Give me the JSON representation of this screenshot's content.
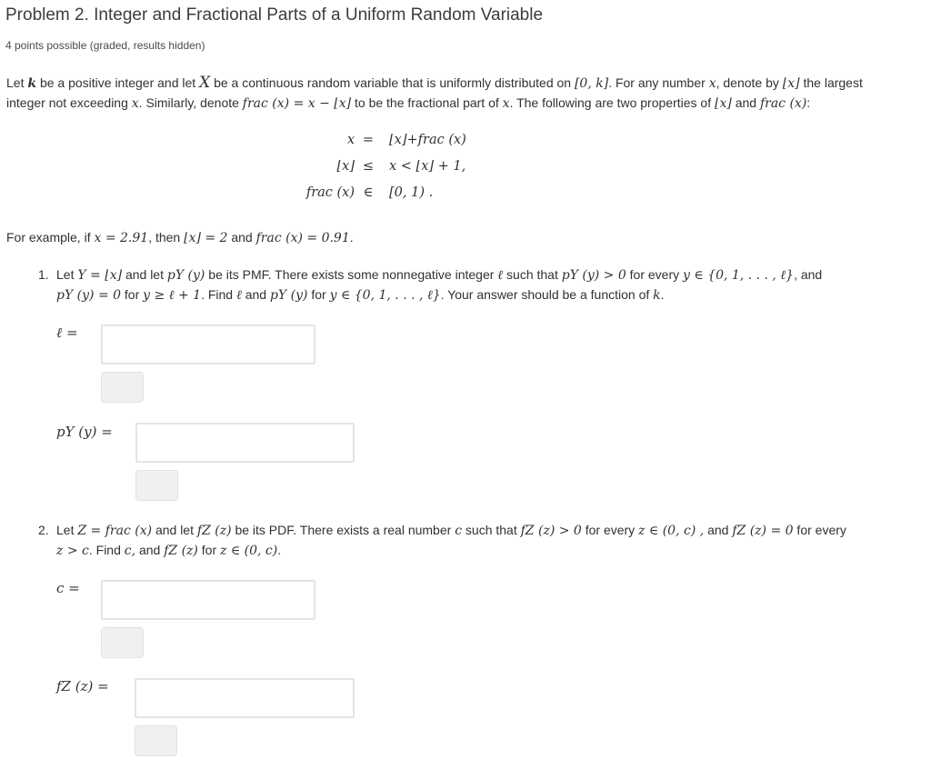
{
  "header": {
    "title": "Problem 2. Integer and Fractional Parts of a Uniform Random Variable",
    "subtitle": "4 points possible (graded, results hidden)"
  },
  "intro": {
    "line1": [
      "Let ",
      "k",
      " be a positive integer and let ",
      "X",
      " be a continuous random variable that is uniformly distributed on ",
      "[0, k]",
      ". For any number ",
      "x",
      ", denote by ",
      "⌊x⌋",
      " the largest"
    ],
    "line2": [
      "integer not exceeding ",
      "x",
      ". Similarly, denote ",
      "frac (x) = x − ⌊x⌋",
      " to be the fractional part of ",
      "x",
      ". The following are two properties of ",
      "⌊x⌋",
      " and ",
      "frac (x)",
      ":"
    ]
  },
  "equations": [
    {
      "lhs": "x",
      "op": "=",
      "rhs": "⌊x⌋+frac (x)"
    },
    {
      "lhs": "⌊x⌋",
      "op": "≤",
      "rhs": "x < ⌊x⌋ + 1,"
    },
    {
      "lhs": "frac (x)",
      "op": "∈",
      "rhs": "[0, 1) ."
    }
  ],
  "example": {
    "parts": [
      "For example, if ",
      "x = 2.91",
      ", then ",
      "⌊x⌋ = 2",
      " and ",
      "frac (x) = 0.91",
      "."
    ]
  },
  "questions": [
    {
      "number": "1.",
      "line1": [
        "Let ",
        "Y = ⌊x⌋",
        " and let ",
        "pY (y)",
        " be its PMF. There exists some nonnegative integer ",
        "ℓ",
        " such that ",
        "pY (y) > 0",
        " for every ",
        "y ∈ {0, 1, . . . , ℓ}",
        ", and"
      ],
      "line2": [
        "pY (y) = 0",
        " for ",
        "y ≥ ℓ + 1",
        ". Find ",
        "ℓ",
        " and ",
        "pY (y)",
        " for ",
        "y ∈ {0, 1, . . . , ℓ}",
        ". Your answer should be a function of ",
        "k",
        "."
      ],
      "answers": [
        {
          "label": "ℓ =",
          "value": "",
          "placeholder": ""
        },
        {
          "label": "pY (y) =",
          "value": "",
          "placeholder": ""
        }
      ]
    },
    {
      "number": "2.",
      "line1": [
        "Let ",
        "Z = frac (x)",
        " and let ",
        "fZ (z)",
        " be its PDF. There exists a real number ",
        "c",
        " such that ",
        "fZ (z) > 0",
        " for every ",
        "z ∈ (0, c) ,",
        " and ",
        "fZ (z) = 0",
        " for every"
      ],
      "line2": [
        "z > c",
        ". Find ",
        "c,",
        " and ",
        "fZ (z)",
        " for ",
        "z ∈ (0, c)",
        "."
      ],
      "answers": [
        {
          "label": "c =",
          "value": "",
          "placeholder": ""
        },
        {
          "label": "fZ (z) =",
          "value": "",
          "placeholder": ""
        }
      ]
    }
  ]
}
